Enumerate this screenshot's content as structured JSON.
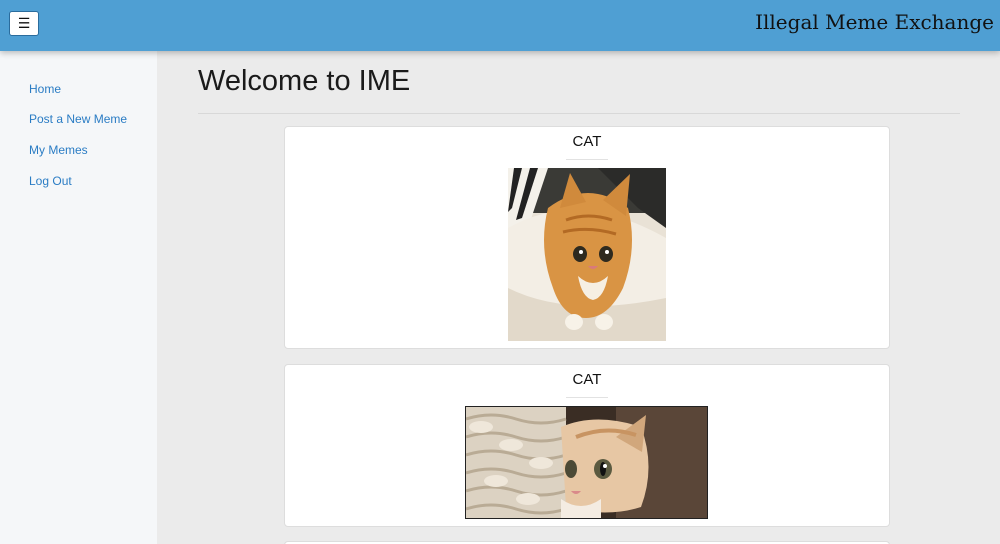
{
  "header": {
    "menu_icon": "☰",
    "app_title": "Illegal Meme Exchange"
  },
  "sidebar": {
    "items": [
      {
        "label": "Home"
      },
      {
        "label": "Post a New Meme"
      },
      {
        "label": "My Memes"
      },
      {
        "label": "Log Out"
      }
    ]
  },
  "main": {
    "title": "Welcome to IME",
    "memes": [
      {
        "title": "CAT",
        "image": "orange-kitten-lying-on-pillow"
      },
      {
        "title": "CAT",
        "image": "kitten-peeking-from-wicker-basket"
      }
    ]
  },
  "colors": {
    "header_bg": "#4f9fd3",
    "link": "#2a7cc4",
    "sidebar_bg": "#f5f7f9",
    "page_bg": "#ebebeb"
  }
}
